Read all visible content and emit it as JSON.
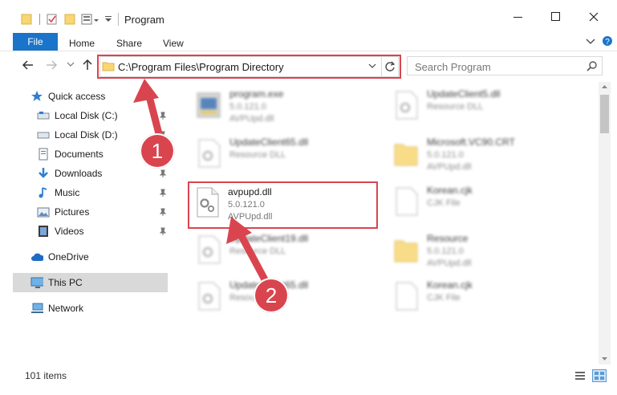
{
  "window": {
    "title": "Program"
  },
  "ribbon": {
    "file": "File",
    "home": "Home",
    "share": "Share",
    "view": "View"
  },
  "address": {
    "path": "C:\\Program Files\\Program Directory"
  },
  "search": {
    "placeholder": "Search Program"
  },
  "sidebar": {
    "items": [
      {
        "label": "Quick access"
      },
      {
        "label": "Local Disk (C:)"
      },
      {
        "label": "Local Disk (D:)"
      },
      {
        "label": "Documents"
      },
      {
        "label": "Downloads"
      },
      {
        "label": "Music"
      },
      {
        "label": "Pictures"
      },
      {
        "label": "Videos"
      },
      {
        "label": "OneDrive"
      },
      {
        "label": "This PC"
      },
      {
        "label": "Network"
      }
    ]
  },
  "files": [
    {
      "name": "program.exe",
      "l2": "5.0.121.0",
      "l3": "AVPUpd.dll"
    },
    {
      "name": "UpdateClient5.dll",
      "l2": "Resource DLL",
      "l3": ""
    },
    {
      "name": "UpdateClient65.dll",
      "l2": "Resource DLL",
      "l3": ""
    },
    {
      "name": "Microsoft.VC90.CRT",
      "l2": "5.0.121.0",
      "l3": "AVPUpd.dll"
    },
    {
      "name": "avpupd.dll",
      "l2": "5.0.121.0",
      "l3": "AVPUpd.dll"
    },
    {
      "name": "Korean.cjk",
      "l2": "CJK File",
      "l3": ""
    },
    {
      "name": "UpdateClient19.dll",
      "l2": "Resource DLL",
      "l3": ""
    },
    {
      "name": "Resource",
      "l2": "5.0.121.0",
      "l3": "AVPUpd.dll"
    },
    {
      "name": "UpdateClient65.dll",
      "l2": "Resource DLL",
      "l3": ""
    },
    {
      "name": "Korean.cjk",
      "l2": "CJK File",
      "l3": ""
    }
  ],
  "status": {
    "count": "101 items"
  },
  "callouts": {
    "one": "1",
    "two": "2"
  },
  "colors": {
    "accent": "#1a74c9",
    "highlight": "#d9454f",
    "selected": "#d9d9d9"
  }
}
